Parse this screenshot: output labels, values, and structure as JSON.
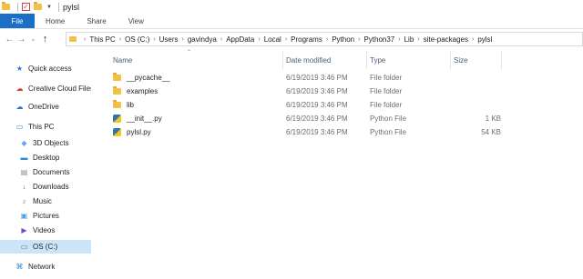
{
  "window": {
    "title": "pylsl"
  },
  "ribbon": {
    "tabs": [
      "File",
      "Home",
      "Share",
      "View"
    ]
  },
  "address": {
    "crumbs": [
      "This PC",
      "OS (C:)",
      "Users",
      "gavindya",
      "AppData",
      "Local",
      "Programs",
      "Python",
      "Python37",
      "Lib",
      "site-packages",
      "pylsl"
    ]
  },
  "nav": {
    "items": [
      {
        "label": "Quick access",
        "icon": "star-icon"
      },
      {
        "label": "Creative Cloud Files",
        "icon": "creative-cloud-icon"
      },
      {
        "label": "OneDrive",
        "icon": "cloud-icon"
      },
      {
        "label": "This PC",
        "icon": "computer-icon"
      },
      {
        "label": "3D Objects",
        "icon": "cube-icon"
      },
      {
        "label": "Desktop",
        "icon": "desktop-icon"
      },
      {
        "label": "Documents",
        "icon": "documents-icon"
      },
      {
        "label": "Downloads",
        "icon": "downloads-icon"
      },
      {
        "label": "Music",
        "icon": "music-icon"
      },
      {
        "label": "Pictures",
        "icon": "pictures-icon"
      },
      {
        "label": "Videos",
        "icon": "videos-icon"
      },
      {
        "label": "OS (C:)",
        "icon": "drive-icon"
      },
      {
        "label": "Network",
        "icon": "network-icon"
      }
    ],
    "selected": "OS (C:)"
  },
  "columns": {
    "name": "Name",
    "date": "Date modified",
    "type": "Type",
    "size": "Size"
  },
  "files": [
    {
      "name": "__pycache__",
      "date": "6/19/2019 3:46 PM",
      "type": "File folder",
      "size": "",
      "icon": "folder-icon"
    },
    {
      "name": "examples",
      "date": "6/19/2019 3:46 PM",
      "type": "File folder",
      "size": "",
      "icon": "folder-icon"
    },
    {
      "name": "lib",
      "date": "6/19/2019 3:46 PM",
      "type": "File folder",
      "size": "",
      "icon": "folder-icon"
    },
    {
      "name": "__init__.py",
      "date": "6/19/2019 3:46 PM",
      "type": "Python File",
      "size": "1 KB",
      "icon": "python-file-icon"
    },
    {
      "name": "pylsl.py",
      "date": "6/19/2019 3:46 PM",
      "type": "Python File",
      "size": "54 KB",
      "icon": "python-file-icon"
    }
  ],
  "colors": {
    "file_tab": "#1a6fc6",
    "selected_nav": "#cce4f7",
    "folder": "#f2c044"
  }
}
